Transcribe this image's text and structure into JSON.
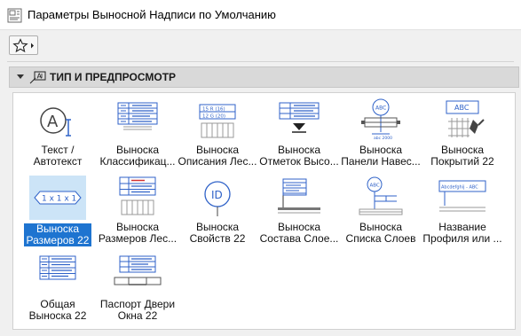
{
  "window": {
    "title": "Параметры Выносной Надписи по Умолчанию"
  },
  "toolbar": {
    "favorites_icon": "star-icon",
    "favorites_arrow_icon": "chevron-right-icon"
  },
  "section": {
    "title": "ТИП И ПРЕДПРОСМОТР",
    "expanded": true,
    "icon": "label-preview-icon"
  },
  "items": [
    {
      "label": "Текст /\nАвтотекст",
      "icon": "text-autotext-icon",
      "selected": false
    },
    {
      "label": "Выноска\nКлассификац...",
      "icon": "classification-label-icon",
      "selected": false
    },
    {
      "label": "Выноска\nОписания Лес...",
      "icon": "stair-description-label-icon",
      "selected": false
    },
    {
      "label": "Выноска\nОтметок Высо...",
      "icon": "elevation-label-icon",
      "selected": false
    },
    {
      "label": "Выноска\nПанели Навес...",
      "icon": "curtain-panel-label-icon",
      "selected": false
    },
    {
      "label": "Выноска\nПокрытий 22",
      "icon": "surface-label-icon",
      "selected": false
    },
    {
      "label": "Выноска\nРазмеров 22",
      "icon": "dimensions-label-icon",
      "selected": true,
      "preview_text": "1 x 1 x 1"
    },
    {
      "label": "Выноска\nРазмеров Лес...",
      "icon": "stair-dimensions-label-icon",
      "selected": false
    },
    {
      "label": "Выноска\nСвойств 22",
      "icon": "properties-label-icon",
      "selected": false,
      "preview_text": "ID"
    },
    {
      "label": "Выноска\nСостава Слое...",
      "icon": "layer-composition-label-icon",
      "selected": false
    },
    {
      "label": "Выноска\nСписка Слоев ...",
      "icon": "layer-list-label-icon",
      "selected": false
    },
    {
      "label": "Название\nПрофиля или ...",
      "icon": "profile-name-label-icon",
      "selected": false
    },
    {
      "label": "Общая\nВыноска 22",
      "icon": "general-label-icon",
      "selected": false
    },
    {
      "label": "Паспорт Двери\nОкна 22",
      "icon": "door-window-passport-icon",
      "selected": false
    }
  ],
  "colors": {
    "selection": "#1e74d0",
    "selection_bg": "#cce4f7",
    "icon_blue": "#2f62c8",
    "icon_dark": "#333333"
  }
}
